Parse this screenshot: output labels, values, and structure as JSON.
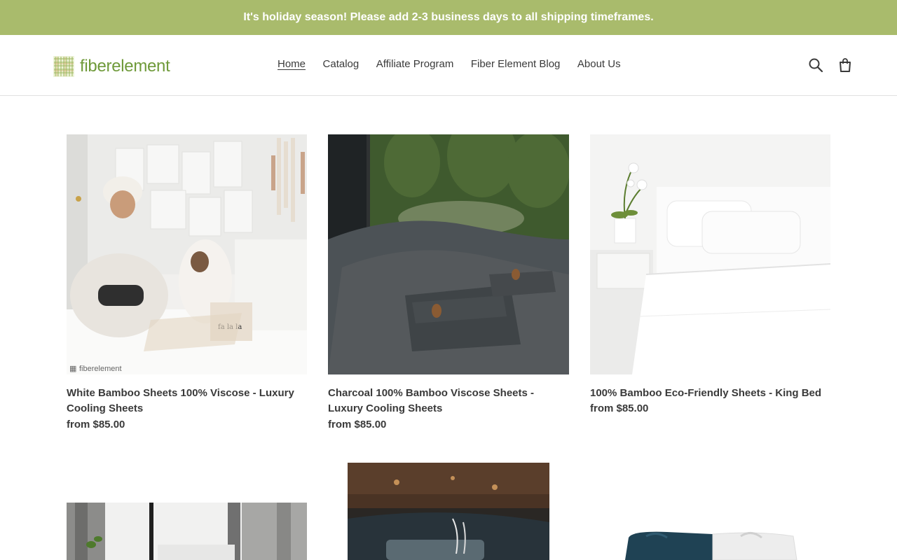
{
  "announcement": {
    "text": "It's holiday season! Please add 2-3 business days to all shipping timeframes."
  },
  "header": {
    "logo_text": "fiberelement",
    "nav": [
      {
        "label": "Home",
        "active": true
      },
      {
        "label": "Catalog",
        "active": false
      },
      {
        "label": "Affiliate Program",
        "active": false
      },
      {
        "label": "Fiber Element Blog",
        "active": false
      },
      {
        "label": "About Us",
        "active": false
      }
    ],
    "icons": [
      "search-icon",
      "cart-icon"
    ]
  },
  "products": [
    {
      "title": "White Bamboo Sheets 100% Viscose - Luxury Cooling Sheets",
      "price": "from $85.00",
      "image_watermark": "fiberelement"
    },
    {
      "title": "Charcoal 100% Bamboo Viscose Sheets - Luxury Cooling Sheets",
      "price": "from $85.00"
    },
    {
      "title": "100% Bamboo Eco-Friendly Sheets - King Bed",
      "price": "from $85.00"
    },
    {
      "title": "",
      "price": ""
    },
    {
      "title": "",
      "price": ""
    },
    {
      "title": "",
      "price": ""
    }
  ],
  "colors": {
    "announcement_bg": "#a9bb6c",
    "brand_green": "#6f9a3a",
    "text": "#3a3a3a"
  }
}
